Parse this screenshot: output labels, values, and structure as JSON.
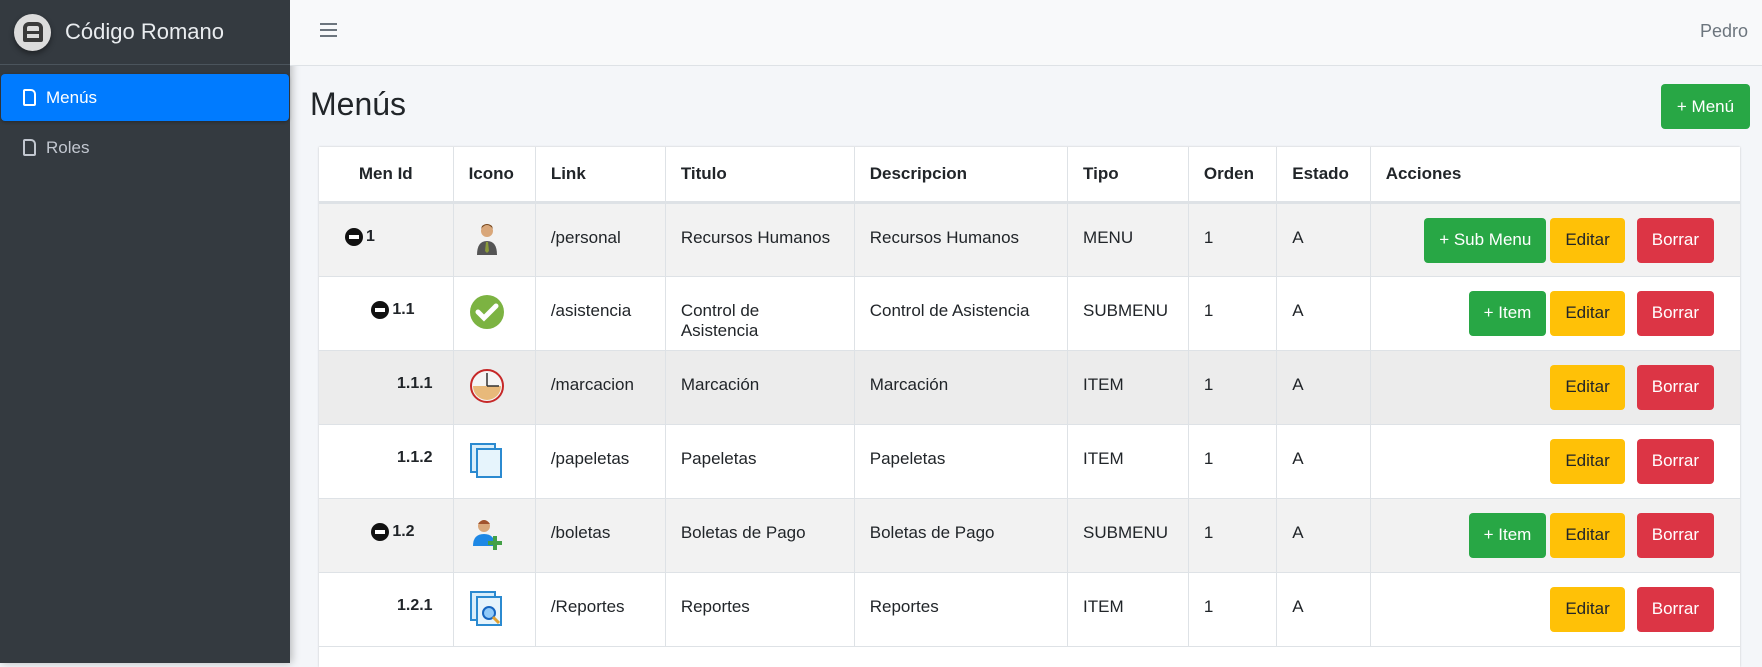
{
  "brand": {
    "name": "Código Romano"
  },
  "sidebar": {
    "items": [
      {
        "label": "Menús",
        "active": true
      },
      {
        "label": "Roles",
        "active": false
      }
    ]
  },
  "topbar": {
    "user": "Pedro"
  },
  "page": {
    "title": "Menús",
    "add_button": "+ Menú"
  },
  "colors": {
    "primary": "#007bff",
    "success": "#28a745",
    "warning": "#ffc107",
    "danger": "#dc3545",
    "sidebar": "#343a40"
  },
  "table": {
    "headers": [
      "Men Id",
      "Icono",
      "Link",
      "Titulo",
      "Descripcion",
      "Tipo",
      "Orden",
      "Estado",
      "Acciones"
    ],
    "rows": [
      {
        "id": "1",
        "collapsible": true,
        "icon": "businessman-icon",
        "link": "/personal",
        "titulo": "Recursos Humanos",
        "descripcion": "Recursos Humanos",
        "tipo": "MENU",
        "orden": "1",
        "estado": "A",
        "add": "+ Sub Menu",
        "edit": "Editar",
        "delete": "Borrar"
      },
      {
        "id": "1.1",
        "collapsible": true,
        "icon": "checkmark-icon",
        "link": "/asistencia",
        "titulo": "Control de Asistencia",
        "descripcion": "Control de Asistencia",
        "tipo": "SUBMENU",
        "orden": "1",
        "estado": "A",
        "add": "+ Item",
        "edit": "Editar",
        "delete": "Borrar"
      },
      {
        "id": "1.1.1",
        "collapsible": false,
        "icon": "clock-icon",
        "link": "/marcacion",
        "titulo": "Marcación",
        "descripcion": "Marcación",
        "tipo": "ITEM",
        "orden": "1",
        "estado": "A",
        "edit": "Editar",
        "delete": "Borrar"
      },
      {
        "id": "1.1.2",
        "collapsible": false,
        "icon": "documents-icon",
        "link": "/papeletas",
        "titulo": "Papeletas",
        "descripcion": "Papeletas",
        "tipo": "ITEM",
        "orden": "1",
        "estado": "A",
        "edit": "Editar",
        "delete": "Borrar"
      },
      {
        "id": "1.2",
        "collapsible": true,
        "icon": "add-user-icon",
        "link": "/boletas",
        "titulo": "Boletas de Pago",
        "descripcion": "Boletas de Pago",
        "tipo": "SUBMENU",
        "orden": "1",
        "estado": "A",
        "add": "+ Item",
        "edit": "Editar",
        "delete": "Borrar"
      },
      {
        "id": "1.2.1",
        "collapsible": false,
        "icon": "document-search-icon",
        "link": "/Reportes",
        "titulo": "Reportes",
        "descripcion": "Reportes",
        "tipo": "ITEM",
        "orden": "1",
        "estado": "A",
        "edit": "Editar",
        "delete": "Borrar"
      }
    ]
  }
}
